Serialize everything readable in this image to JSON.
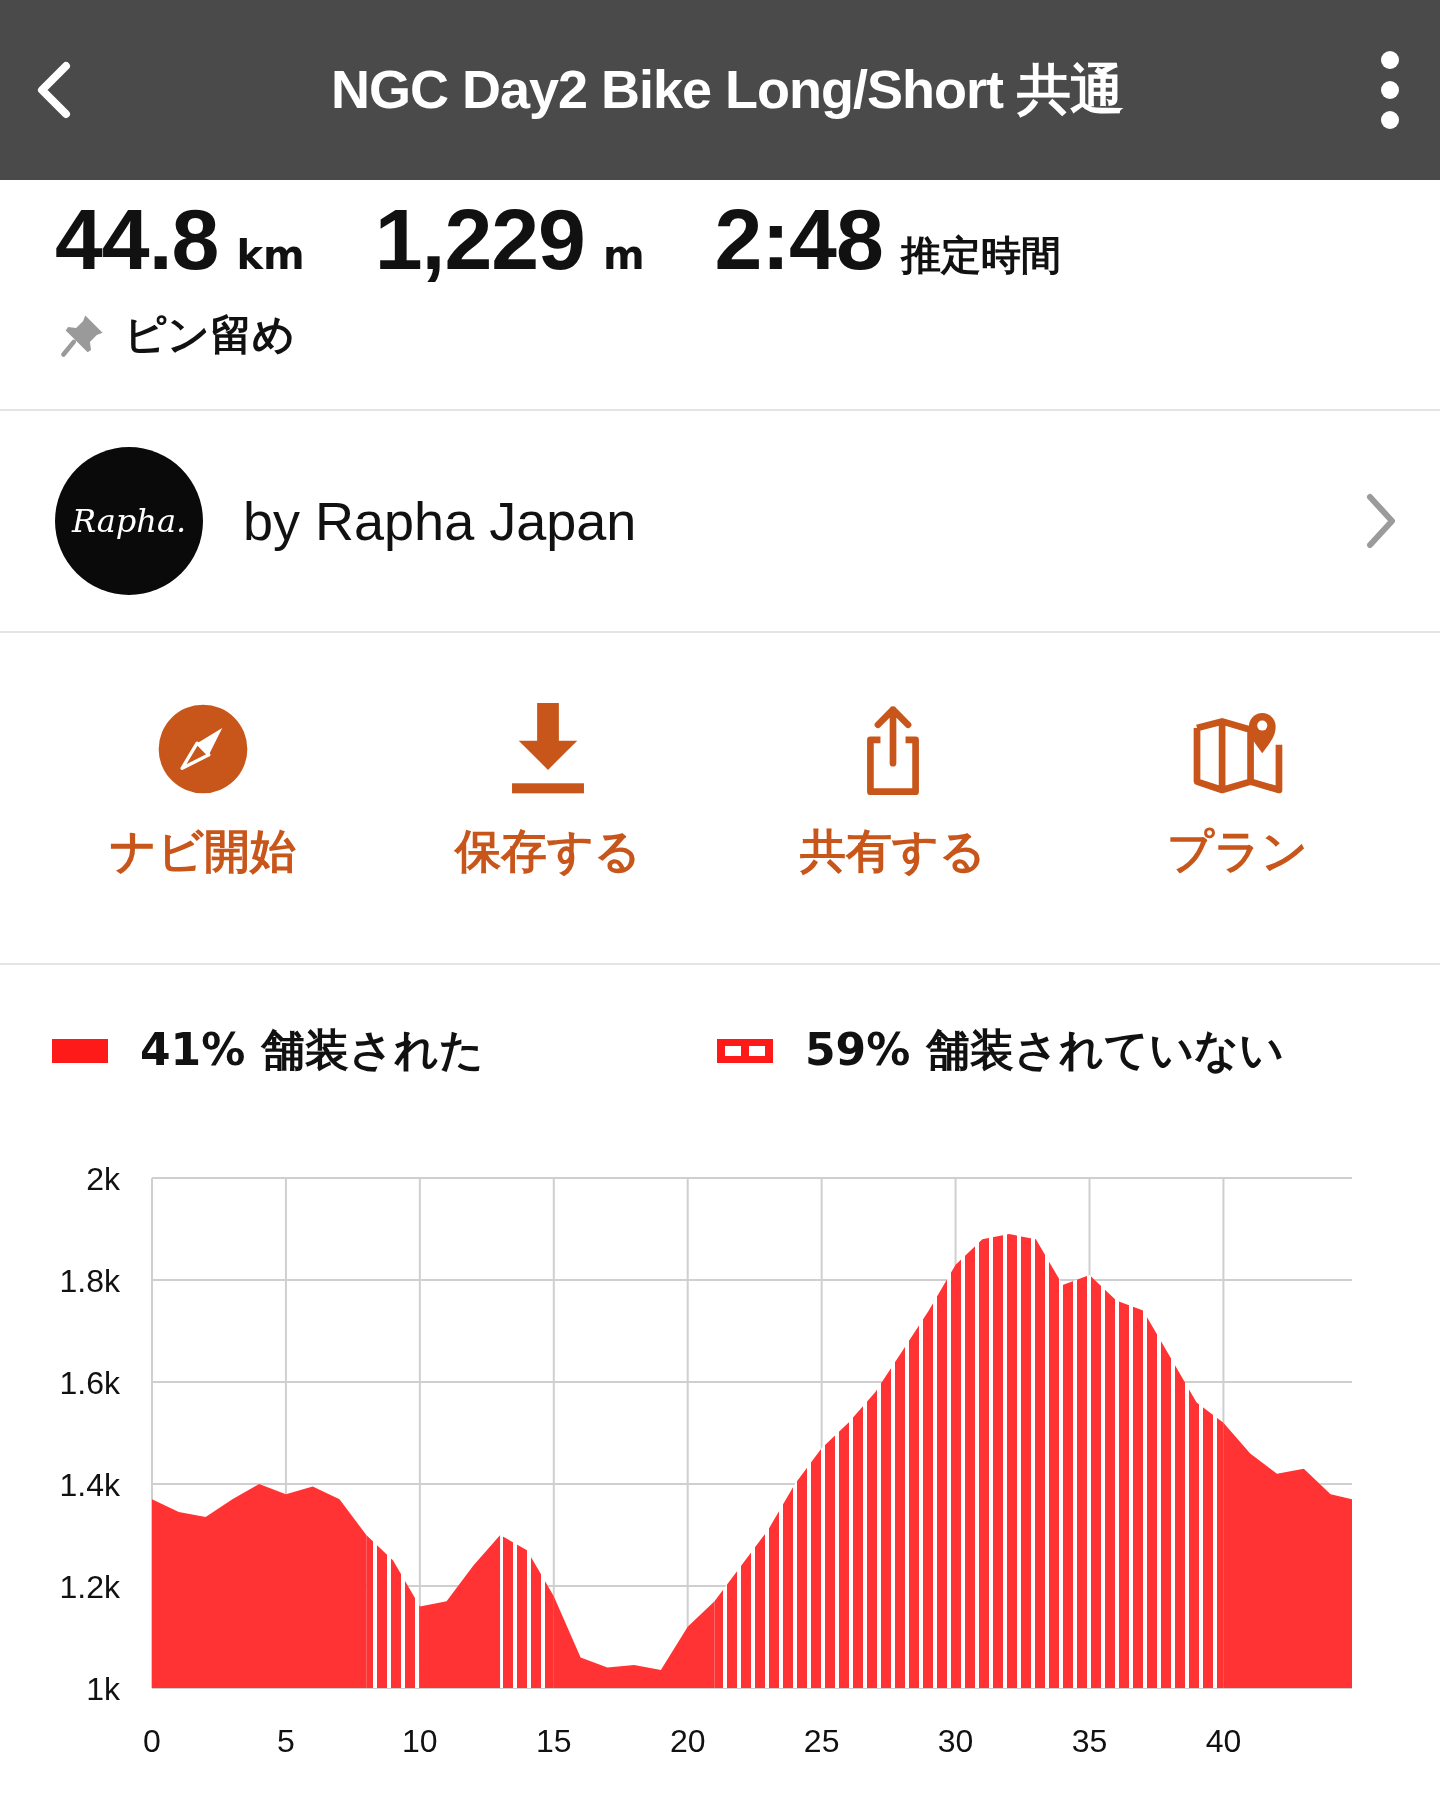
{
  "header": {
    "title": "NGC Day2 Bike Long/Short 共通"
  },
  "stats": [
    {
      "value": "44.8",
      "unit": "km"
    },
    {
      "value": "1,229",
      "unit": "m"
    },
    {
      "value": "2:48",
      "unit": "推定時間"
    }
  ],
  "pin": {
    "label": "ピン留め"
  },
  "author": {
    "logo_text": "Rapha.",
    "name": "by Rapha Japan"
  },
  "actions": [
    {
      "kind": "navigate",
      "label": "ナビ開始"
    },
    {
      "kind": "save",
      "label": "保存する"
    },
    {
      "kind": "share",
      "label": "共有する"
    },
    {
      "kind": "plan",
      "label": "プラン"
    }
  ],
  "legend": [
    {
      "kind": "paved",
      "percent": "41%"
    },
    {
      "kind": "unpaved",
      "percent": "59%"
    }
  ],
  "elevation": {
    "chart_data": {
      "type": "area",
      "x": [
        0,
        1,
        2,
        3,
        4,
        5,
        6,
        7,
        8,
        9,
        10,
        11,
        12,
        13,
        14,
        15,
        16,
        17,
        18,
        19,
        20,
        21,
        22,
        23,
        24,
        25,
        26,
        27,
        28,
        29,
        30,
        31,
        32,
        33,
        34,
        35,
        36,
        37,
        38,
        39,
        40,
        41,
        42,
        43,
        44,
        44.8
      ],
      "series": [
        {
          "name": "舗装された",
          "color": "#ff3333",
          "values": [
            1370,
            1345,
            1335,
            1370,
            1400,
            1380,
            1395,
            1370,
            1300,
            null,
            1160,
            1170,
            1240,
            1300,
            null,
            1180,
            1060,
            1040,
            1045,
            1035,
            1120,
            1170,
            null,
            null,
            null,
            null,
            null,
            null,
            null,
            null,
            null,
            null,
            null,
            null,
            null,
            null,
            null,
            null,
            null,
            null,
            1520,
            1460,
            1420,
            1430,
            1380,
            1370
          ]
        },
        {
          "name": "舗装されていない",
          "color": "#ff3333",
          "values": [
            null,
            null,
            null,
            null,
            null,
            null,
            null,
            null,
            1300,
            1250,
            1160,
            null,
            null,
            1300,
            1270,
            1180,
            null,
            null,
            null,
            null,
            null,
            1170,
            1240,
            1310,
            1400,
            1470,
            1520,
            1580,
            1660,
            1740,
            1830,
            1880,
            1890,
            1880,
            1790,
            1810,
            1760,
            1740,
            1650,
            1560,
            1520,
            null,
            null,
            null,
            null,
            null
          ]
        }
      ],
      "grid": true,
      "xlim": [
        0,
        44.8
      ],
      "ylim": [
        1000,
        2000
      ],
      "xticks": [
        0,
        5,
        10,
        15,
        20,
        25,
        30,
        35,
        40
      ],
      "yticks": [
        {
          "value": 1000,
          "label": "1k"
        },
        {
          "value": 1200,
          "label": "1.2k"
        },
        {
          "value": 1400,
          "label": "1.4k"
        },
        {
          "value": 1600,
          "label": "1.6k"
        },
        {
          "value": 1800,
          "label": "1.8k"
        },
        {
          "value": 2000,
          "label": "2k"
        }
      ]
    }
  }
}
